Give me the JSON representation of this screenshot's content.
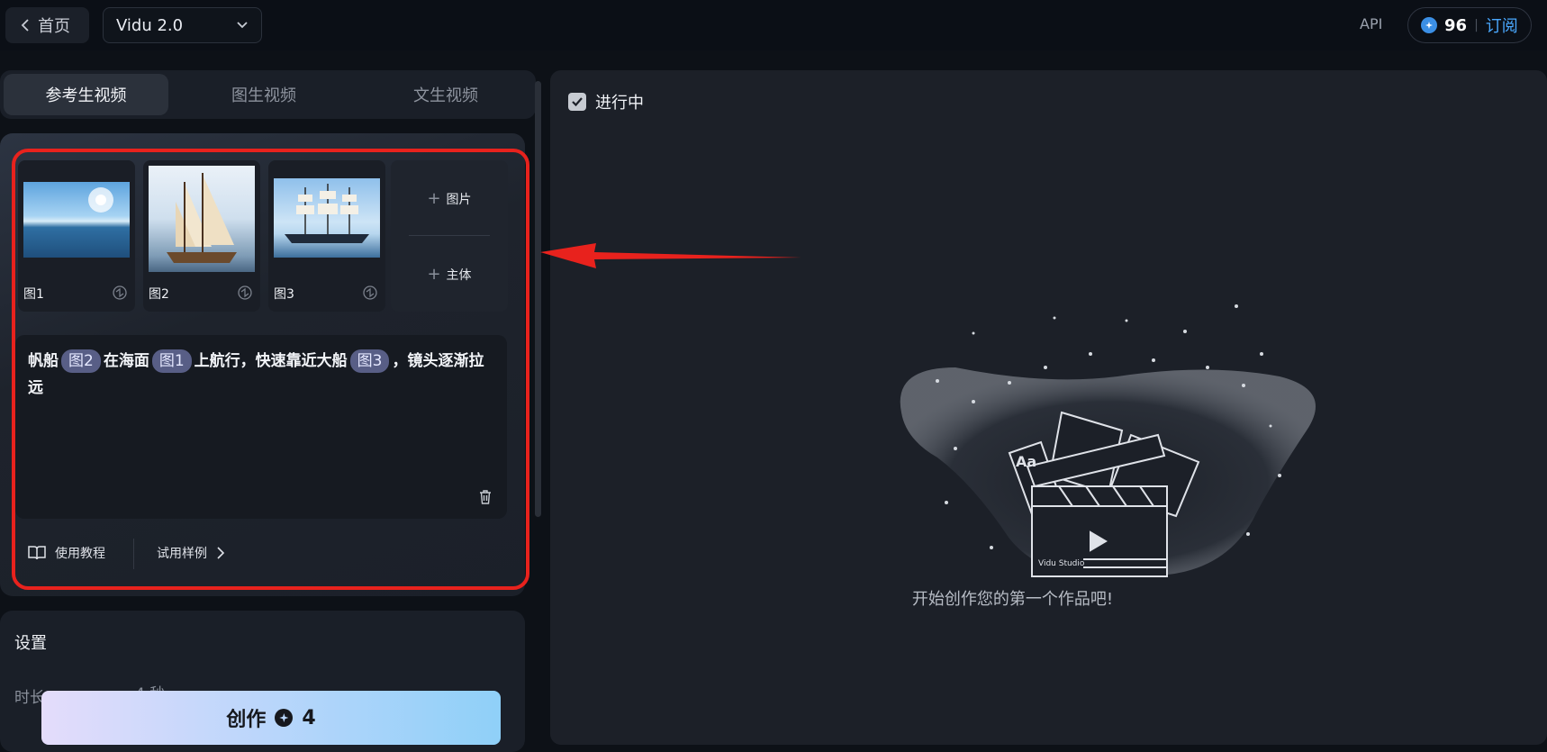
{
  "header": {
    "home_label": "首页",
    "model_value": "Vidu 2.0",
    "api_label": "API",
    "credits_value": "96",
    "subscribe_label": "订阅"
  },
  "tabs": [
    {
      "label": "参考生视频",
      "active": true
    },
    {
      "label": "图生视频",
      "active": false
    },
    {
      "label": "文生视频",
      "active": false
    }
  ],
  "references": {
    "images": [
      {
        "label": "图1"
      },
      {
        "label": "图2"
      },
      {
        "label": "图3"
      }
    ],
    "add_image_label": "图片",
    "add_subject_label": "主体"
  },
  "prompt": {
    "segments": [
      "帆船",
      "图2",
      "在海面",
      "图1",
      "上航行，快速靠近大船",
      "图3",
      "，镜头逐渐拉远"
    ]
  },
  "links": {
    "tutorial_label": "使用教程",
    "sample_label": "试用样例"
  },
  "settings": {
    "title": "设置",
    "duration_label": "时长",
    "duration_value": "4 秒"
  },
  "create": {
    "label": "创作",
    "cost": "4"
  },
  "results": {
    "filter_label": "进行中",
    "filter_checked": true,
    "empty_text": "开始创作您的第一个作品吧!",
    "illustration_brand": "Vidu Studio"
  },
  "colors": {
    "accent": "#4aa8ff",
    "highlight": "#e8221d",
    "chip": "#585e86"
  }
}
